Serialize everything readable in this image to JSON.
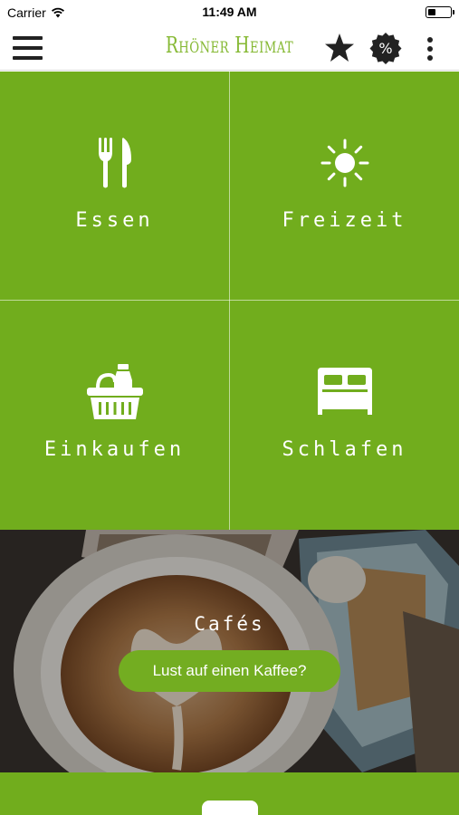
{
  "status_bar": {
    "carrier": "Carrier",
    "time": "11:49 AM",
    "icons": [
      "wifi-icon",
      "battery-icon"
    ]
  },
  "nav": {
    "title": "Rhöner Heimat",
    "title_color": "#86b934",
    "menu_icon": "hamburger-icon",
    "favorites_icon": "star-icon",
    "discount_icon": "discount-badge-icon",
    "discount_symbol": "%",
    "more_icon": "more-vertical-icon"
  },
  "tiles": [
    {
      "label": "Essen",
      "icon": "fork-knife-icon"
    },
    {
      "label": "Freizeit",
      "icon": "sun-icon"
    },
    {
      "label": "Einkaufen",
      "icon": "shopping-basket-icon"
    },
    {
      "label": "Schlafen",
      "icon": "bed-icon"
    }
  ],
  "tile_color": "#71ad1d",
  "banner": {
    "title": "Cafés",
    "cta": "Lust auf einen Kaffee?",
    "cta_color": "#73ad21"
  }
}
